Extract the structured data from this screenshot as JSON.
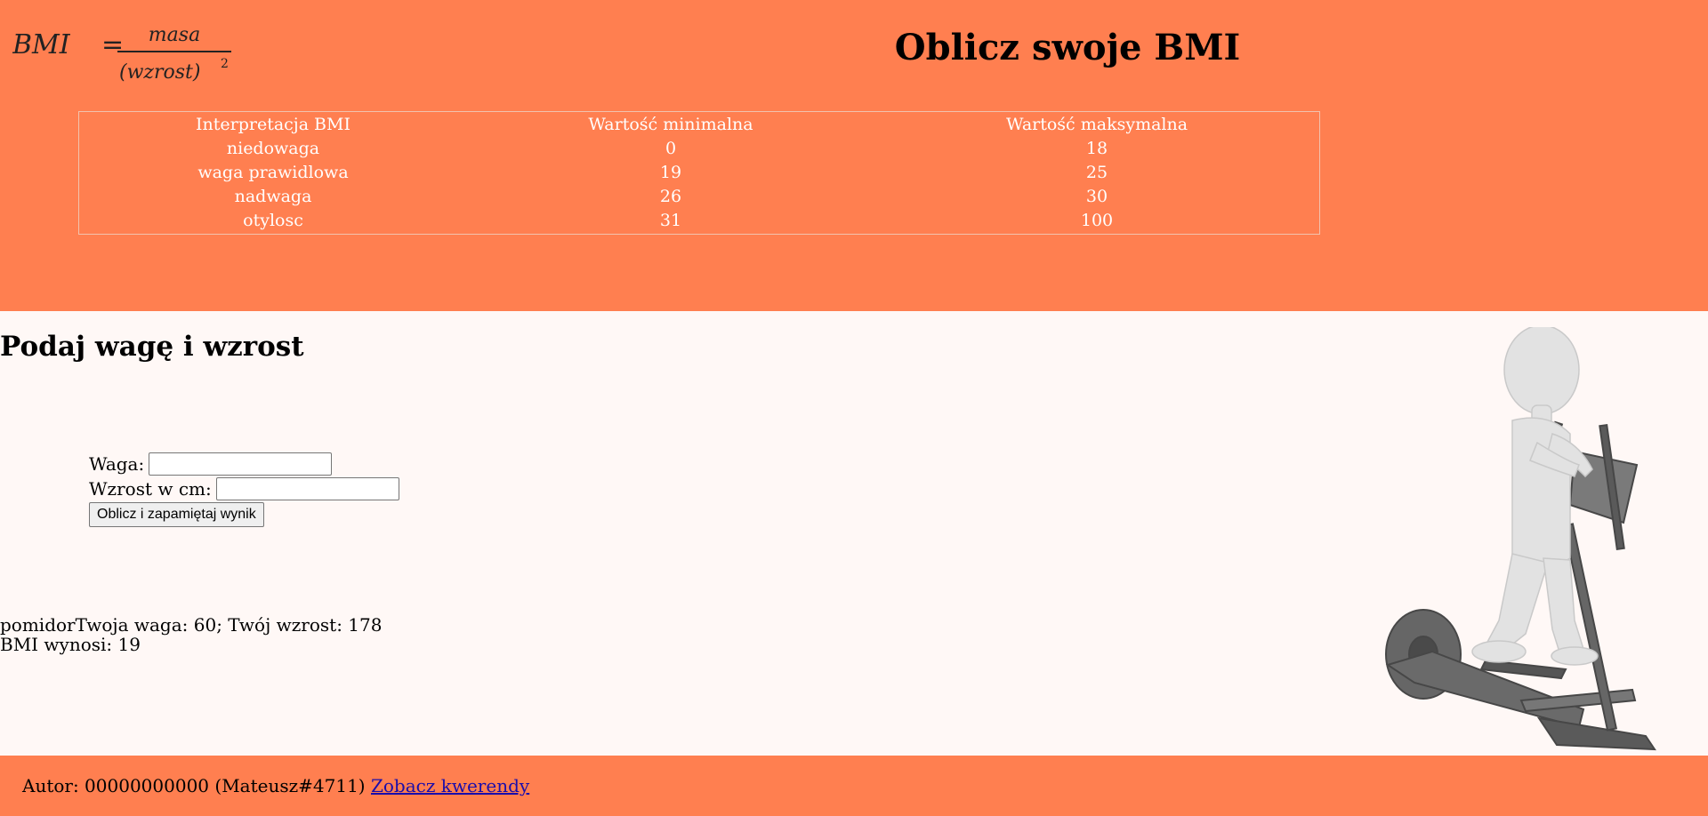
{
  "header": {
    "formula": {
      "lhs": "BMI",
      "equals": "=",
      "numerator": "masa",
      "denominator": "(wzrost)",
      "exponent": "2"
    },
    "title": "Oblicz swoje BMI"
  },
  "bmi_table": {
    "columns": [
      "Interpretacja BMI",
      "Wartość minimalna",
      "Wartość maksymalna"
    ],
    "rows": [
      [
        "niedowaga",
        "0",
        "18"
      ],
      [
        "waga prawidlowa",
        "19",
        "25"
      ],
      [
        "nadwaga",
        "26",
        "30"
      ],
      [
        "otylosc",
        "31",
        "100"
      ]
    ]
  },
  "main": {
    "heading": "Podaj wagę i wzrost",
    "form": {
      "weight_label": "Waga:",
      "weight_value": "",
      "height_label": "Wzrost w cm:",
      "height_value": "",
      "submit_label": "Oblicz i zapamiętaj wynik"
    },
    "result": {
      "line1": "pomidorTwoja waga: 60; Twój wzrost: 178",
      "line2": "BMI wynosi: 19"
    }
  },
  "footer": {
    "author_text": "Autor: 00000000000 (Mateusz#4711)",
    "link_label": "Zobacz kwerendy"
  },
  "colors": {
    "accent": "#ff7f50",
    "background": "#fff8f6",
    "table_text": "#ffffff",
    "link": "#1a0dab"
  }
}
